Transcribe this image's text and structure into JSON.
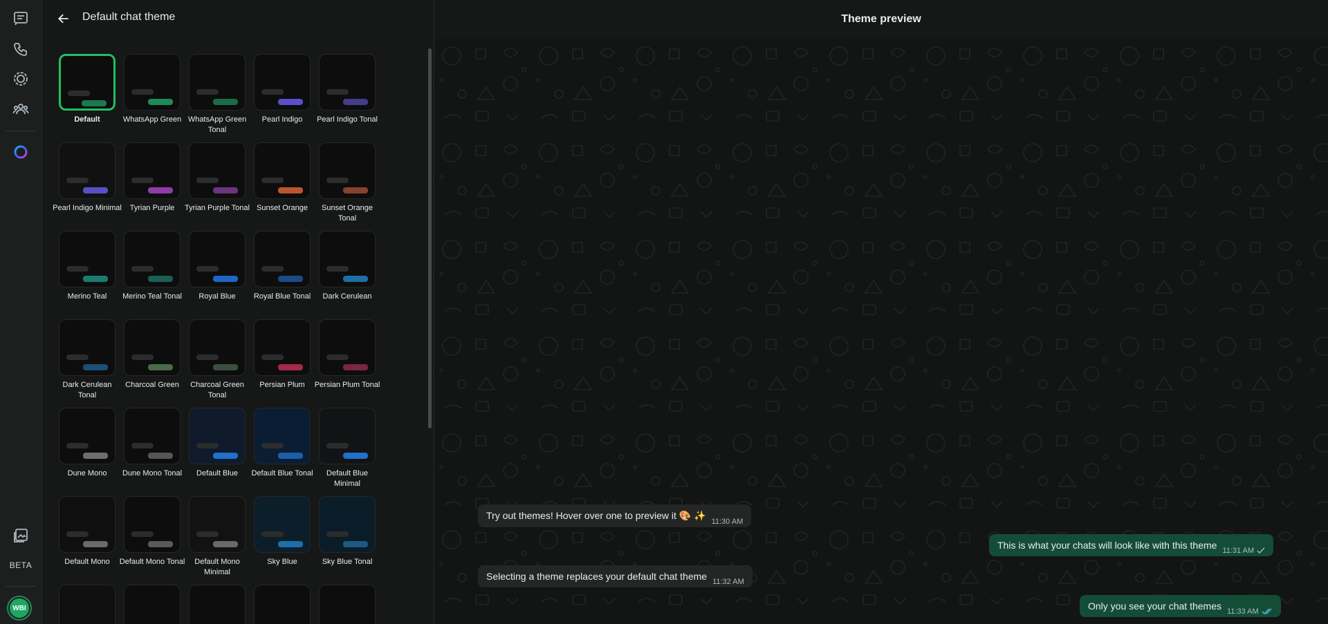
{
  "rail": {
    "beta_label": "BETA",
    "avatar_initials": "WBI",
    "icons": [
      "chats-icon",
      "calls-icon",
      "status-icon",
      "communities-icon",
      "meta-ai-icon",
      "media-icon"
    ]
  },
  "panel": {
    "title": "Default chat theme"
  },
  "themes": [
    {
      "label": "Default",
      "accent": "#1c7a4e",
      "bg": "#0d0d0d",
      "selected": true
    },
    {
      "label": "WhatsApp Green",
      "accent": "#1e8a5a",
      "bg": "#0d0d0d"
    },
    {
      "label": "WhatsApp Green Tonal",
      "accent": "#1b6b47",
      "bg": "#0d0d0d"
    },
    {
      "label": "Pearl Indigo",
      "accent": "#5b4fc8",
      "bg": "#0d0d0d"
    },
    {
      "label": "Pearl Indigo Tonal",
      "accent": "#433d8a",
      "bg": "#0d0d0d"
    },
    {
      "label": "Pearl Indigo Minimal",
      "accent": "#5b4fc8",
      "bg": "#111112"
    },
    {
      "label": "Tyrian Purple",
      "accent": "#8e3da6",
      "bg": "#0d0d0d"
    },
    {
      "label": "Tyrian Purple Tonal",
      "accent": "#6c3380",
      "bg": "#0d0d0d"
    },
    {
      "label": "Sunset Orange",
      "accent": "#b9562f",
      "bg": "#0d0d0d"
    },
    {
      "label": "Sunset Orange Tonal",
      "accent": "#874130",
      "bg": "#0d0d0d"
    },
    {
      "label": "Merino Teal",
      "accent": "#1d7a6e",
      "bg": "#0d0d0d"
    },
    {
      "label": "Merino Teal Tonal",
      "accent": "#1a5e56",
      "bg": "#0d0d0d"
    },
    {
      "label": "Royal Blue",
      "accent": "#2165c4",
      "bg": "#0d0d0d"
    },
    {
      "label": "Royal Blue Tonal",
      "accent": "#1c4a86",
      "bg": "#0d0d0d"
    },
    {
      "label": "Dark Cerulean",
      "accent": "#1f6ea3",
      "bg": "#0d0d0d"
    },
    {
      "label": "Dark Cerulean Tonal",
      "accent": "#1a4e72",
      "bg": "#0d0d0d"
    },
    {
      "label": "Charcoal Green",
      "accent": "#4a6a4a",
      "bg": "#0d0d0d"
    },
    {
      "label": "Charcoal Green Tonal",
      "accent": "#3b4f3f",
      "bg": "#0d0d0d"
    },
    {
      "label": "Persian Plum",
      "accent": "#a32b4a",
      "bg": "#0d0d0d"
    },
    {
      "label": "Persian Plum Tonal",
      "accent": "#7a2740",
      "bg": "#0d0d0d"
    },
    {
      "label": "Dune Mono",
      "accent": "#6e6e6e",
      "bg": "#0d0d0d"
    },
    {
      "label": "Dune Mono Tonal",
      "accent": "#565656",
      "bg": "#0d0d0d"
    },
    {
      "label": "Default Blue",
      "accent": "#1f71c9",
      "bg": "#0f1a2b"
    },
    {
      "label": "Default Blue Tonal",
      "accent": "#1c5fa6",
      "bg": "#0b1d33"
    },
    {
      "label": "Default Blue Minimal",
      "accent": "#1f71c9",
      "bg": "#121314"
    },
    {
      "label": "Default Mono",
      "accent": "#6a6a6a",
      "bg": "#0f0f0f"
    },
    {
      "label": "Default Mono Tonal",
      "accent": "#5a5a5a",
      "bg": "#0d0d0d"
    },
    {
      "label": "Default Mono Minimal",
      "accent": "#6a6a6a",
      "bg": "#121212"
    },
    {
      "label": "Sky Blue",
      "accent": "#1f6fa8",
      "bg": "#0d1e2b"
    },
    {
      "label": "Sky Blue Tonal",
      "accent": "#1c5a82",
      "bg": "#0b1c29"
    },
    {
      "label": "",
      "accent": "",
      "bg": "#0f0f0f"
    },
    {
      "label": "",
      "accent": "",
      "bg": "#0d0d0d"
    },
    {
      "label": "",
      "accent": "",
      "bg": "#0d0d0d"
    },
    {
      "label": "",
      "accent": "",
      "bg": "#0d0d0d"
    },
    {
      "label": "",
      "accent": "",
      "bg": "#0d0d0d"
    }
  ],
  "preview": {
    "title": "Theme preview",
    "messages": [
      {
        "direction": "in",
        "text": "Try out themes! Hover over one to preview it 🎨 ✨",
        "time": "11:30 AM",
        "status": ""
      },
      {
        "direction": "out",
        "text": "This is what your chats will look like with this theme",
        "time": "11:31 AM",
        "status": "sent"
      },
      {
        "direction": "in",
        "text": "Selecting a theme replaces your default chat theme",
        "time": "11:32 AM",
        "status": ""
      },
      {
        "direction": "out",
        "text": "Only you see your chat themes",
        "time": "11:33 AM",
        "status": "read"
      }
    ]
  },
  "colors": {
    "selected_border": "#21c063",
    "outgoing_bubble": "#144d37",
    "incoming_bubble": "#242626",
    "read_tick": "#53bdeb"
  }
}
